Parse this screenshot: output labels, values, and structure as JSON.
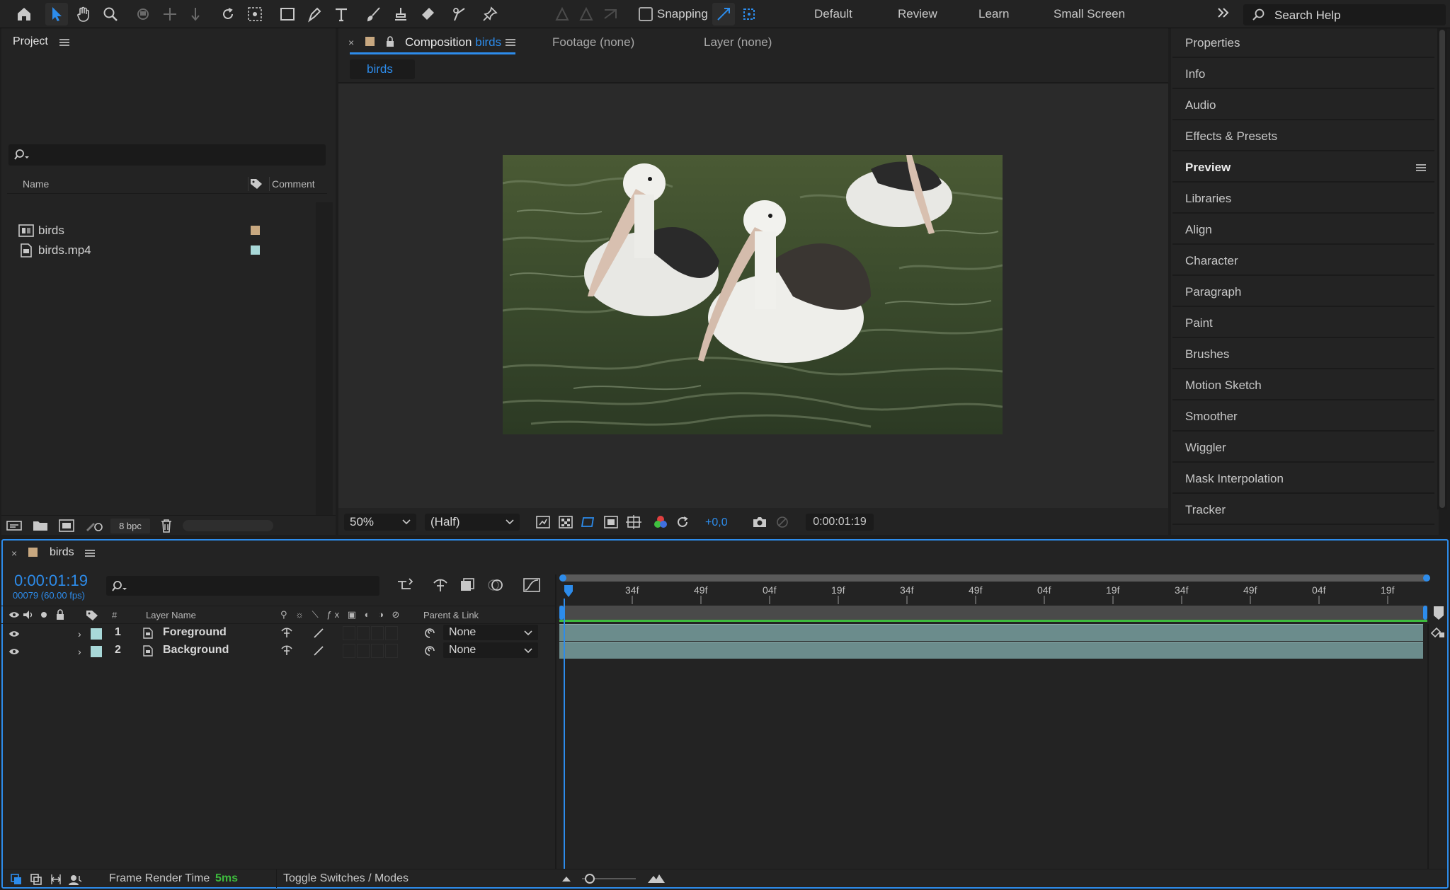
{
  "toolbar": {
    "snapping_label": "Snapping",
    "workspaces": [
      "Default",
      "Review",
      "Learn",
      "Small Screen"
    ],
    "search_placeholder": "Search Help"
  },
  "project": {
    "title": "Project",
    "columns": {
      "name": "Name",
      "comment": "Comment"
    },
    "items": [
      {
        "name": "birds",
        "type": "composition",
        "label_color": "#c8a880"
      },
      {
        "name": "birds.mp4",
        "type": "footage",
        "label_color": "#a8d8d8"
      }
    ],
    "bpc": "8 bpc"
  },
  "composition": {
    "tab_prefix": "Composition",
    "tab_name": "birds",
    "footage_tab": "Footage (none)",
    "layer_tab": "Layer (none)",
    "breadcrumb": "birds",
    "zoom": "50%",
    "resolution": "(Half)",
    "exposure": "+0,0",
    "timecode": "0:00:01:19"
  },
  "right_panel": {
    "items": [
      "Properties",
      "Info",
      "Audio",
      "Effects & Presets",
      "Preview",
      "Libraries",
      "Align",
      "Character",
      "Paragraph",
      "Paint",
      "Brushes",
      "Motion Sketch",
      "Smoother",
      "Wiggler",
      "Mask Interpolation",
      "Tracker"
    ],
    "active": "Preview"
  },
  "timeline": {
    "comp_name": "birds",
    "current_time": "0:00:01:19",
    "frame_info": "00079 (60.00 fps)",
    "columns": {
      "number": "#",
      "layer_name": "Layer Name",
      "parent": "Parent & Link"
    },
    "layers": [
      {
        "num": "1",
        "name": "Foreground",
        "parent": "None"
      },
      {
        "num": "2",
        "name": "Background",
        "parent": "None"
      }
    ],
    "ruler_labels": [
      "34f",
      "49f",
      "04f",
      "19f",
      "34f",
      "49f",
      "04f",
      "19f",
      "34f",
      "49f",
      "04f",
      "19f"
    ],
    "footer": {
      "render_label": "Frame Render Time",
      "render_value": "5ms",
      "toggle_label": "Toggle Switches / Modes"
    },
    "colors": {
      "accent": "#2d8ceb",
      "layer_bar": "#6b8c8c",
      "work_area": "#3dbb3d"
    }
  }
}
